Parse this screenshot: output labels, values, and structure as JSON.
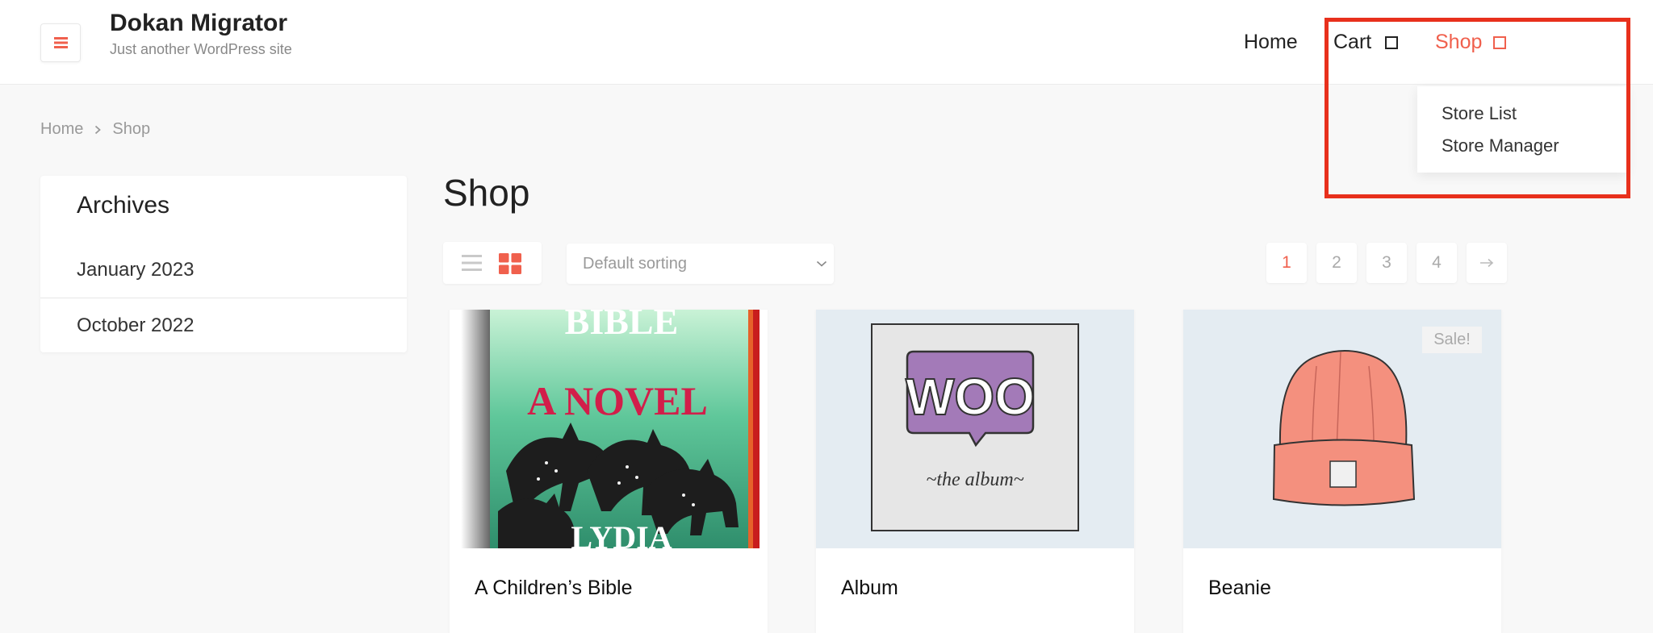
{
  "header": {
    "site_title": "Dokan Migrator",
    "site_description": "Just another WordPress site",
    "nav": {
      "home": "Home",
      "cart": "Cart",
      "shop": "Shop"
    },
    "shop_dropdown": [
      "Store List",
      "Store Manager"
    ]
  },
  "breadcrumb": {
    "home": "Home",
    "current": "Shop"
  },
  "sidebar": {
    "title": "Archives",
    "items": [
      "January 2023",
      "October 2022"
    ]
  },
  "main": {
    "title": "Shop",
    "sorting": "Default sorting",
    "pagination": [
      "1",
      "2",
      "3",
      "4"
    ],
    "products": [
      {
        "name": "A Children’s Bible",
        "cover_text_top": "BIBLE",
        "cover_text_mid": "A NOVEL",
        "cover_text_bottom": "LYDIA"
      },
      {
        "name": "Album",
        "cover_text_top": "WOO",
        "cover_text_bottom": "~the album~"
      },
      {
        "name": "Beanie",
        "badge": "Sale!"
      }
    ]
  },
  "colors": {
    "accent": "#f0604d",
    "highlight": "#e8301c"
  }
}
